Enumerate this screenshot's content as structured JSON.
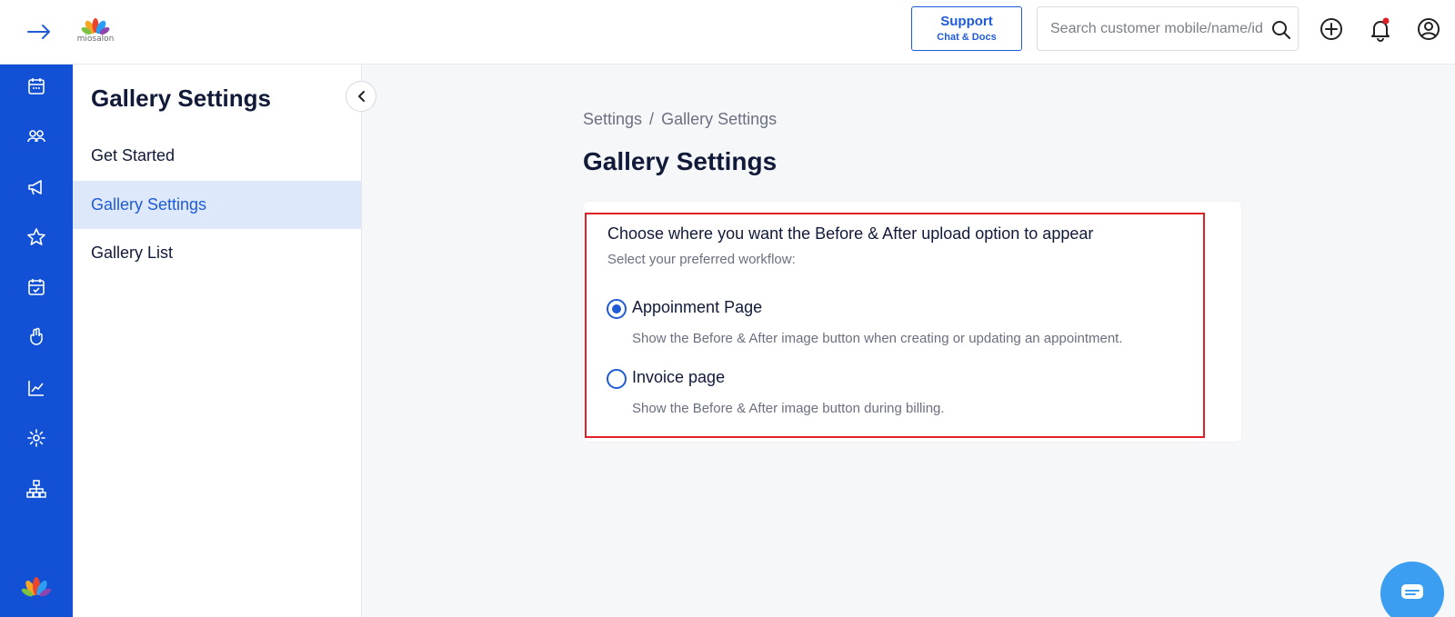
{
  "header": {
    "logo_text": "miosalon",
    "support": {
      "title": "Support",
      "subtitle": "Chat & Docs"
    },
    "search": {
      "placeholder": "Search customer mobile/name/id"
    }
  },
  "left_nav": {
    "items": [
      "calendar-icon",
      "customers-icon",
      "megaphone-icon",
      "star-icon",
      "calendar-check-icon",
      "hand-icon",
      "chart-icon",
      "gear-icon",
      "sitemap-icon"
    ]
  },
  "sidebar": {
    "title": "Gallery Settings",
    "items": [
      {
        "label": "Get Started",
        "active": false
      },
      {
        "label": "Gallery Settings",
        "active": true
      },
      {
        "label": "Gallery List",
        "active": false
      }
    ]
  },
  "main": {
    "breadcrumb": {
      "parent": "Settings",
      "separator": "/",
      "current": "Gallery Settings"
    },
    "title": "Gallery Settings",
    "card": {
      "heading": "Choose where you want the Before & After upload option to appear",
      "subheading": "Select your preferred workflow:",
      "options": [
        {
          "label": "Appoinment Page",
          "description": "Show the Before & After image button when creating or updating an appointment.",
          "selected": true
        },
        {
          "label": "Invoice page",
          "description": "Show the Before & After image button during billing.",
          "selected": false
        }
      ]
    }
  },
  "colors": {
    "primary": "#1f5bd7",
    "nav_bg": "#1251d6",
    "highlight_border": "#e01f26",
    "active_item_bg": "#dde9fb"
  }
}
